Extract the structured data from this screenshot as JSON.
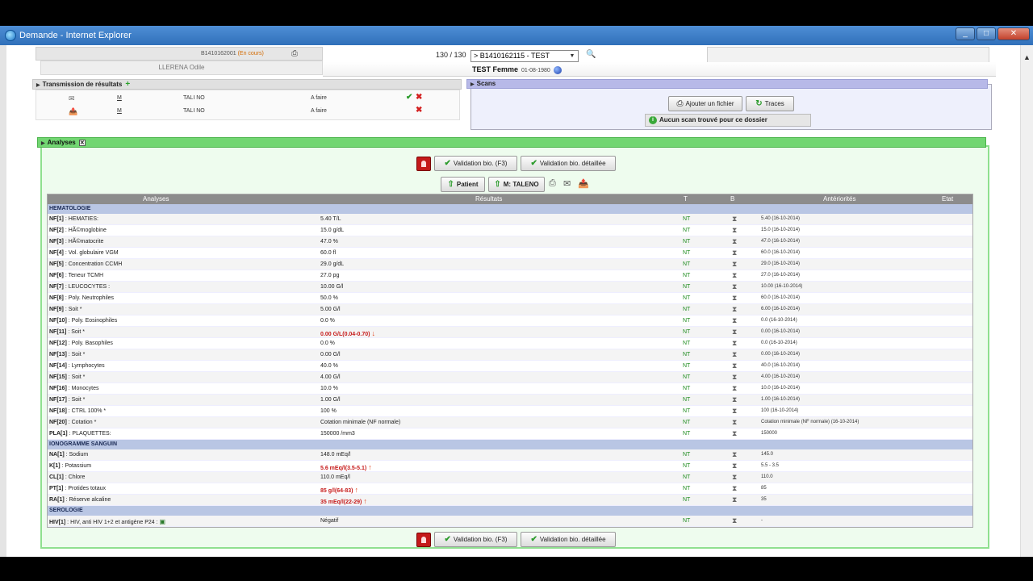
{
  "window": {
    "title": "Demande - Internet Explorer",
    "min": "_",
    "max": "□",
    "close": "✕"
  },
  "header": {
    "code": "B1410162001",
    "status": "(En cours)",
    "patient_sub": "LLERENA Odile",
    "nav_count": "130 / 130",
    "select_value": "> B1410162115 - TEST",
    "patient_name": "TEST Femme",
    "patient_dob": "01-08-1980"
  },
  "transmission": {
    "title": "Transmission de résultats",
    "rows": [
      {
        "m": "M",
        "name": "TALI NO",
        "status": "A faire"
      },
      {
        "m": "M",
        "name": "TALI NO",
        "status": "A faire"
      }
    ]
  },
  "scans": {
    "title": "Scans",
    "add_file": "Ajouter un fichier",
    "traces": "Traces",
    "none_found": "Aucun scan trouvé pour ce dossier"
  },
  "analyses": {
    "title": "Analyses",
    "validate": "Validation bio. (F3)",
    "validate_detail": "Validation bio. détaillée",
    "patient_btn": "Patient",
    "doctor_btn": "M: TALENO",
    "columns": {
      "analyses": "Analyses",
      "results": "Résultats",
      "t": "T",
      "b": "B",
      "anteriorities": "Antériorités",
      "state": "Etat"
    },
    "sections": [
      {
        "name": "HEMATOLOGIE",
        "rows": [
          {
            "code": "NF[1]",
            "label": " : HEMATIES:",
            "result": "5.40 T/L",
            "t": "NT",
            "ant": "5.40 (16-10-2014)"
          },
          {
            "code": "NF[2]",
            "label": " : HÃ©moglobine",
            "result": "15.0 g/dL",
            "t": "NT",
            "ant": "15.0 (16-10-2014)"
          },
          {
            "code": "NF[3]",
            "label": " : HÃ©matocrite",
            "result": "47.0 %",
            "t": "NT",
            "ant": "47.0 (16-10-2014)"
          },
          {
            "code": "NF[4]",
            "label": " : Vol. globulaire VGM",
            "result": "60.0 fl",
            "t": "NT",
            "ant": "60.0 (16-10-2014)"
          },
          {
            "code": "NF[5]",
            "label": " : Concentration CCMH",
            "result": "29.0 g/dL",
            "t": "NT",
            "ant": "29.0 (16-10-2014)"
          },
          {
            "code": "NF[6]",
            "label": " : Teneur TCMH",
            "result": "27.0 pg",
            "t": "NT",
            "ant": "27.0 (16-10-2014)"
          },
          {
            "code": "NF[7]",
            "label": " : LEUCOCYTES :",
            "result": "10.00 G/l",
            "t": "NT",
            "ant": "10.00 (16-10-2014)"
          },
          {
            "code": "NF[8]",
            "label": " : Poly. Neutrophiles",
            "result": "50.0 %",
            "t": "NT",
            "ant": "60.0 (16-10-2014)"
          },
          {
            "code": "NF[9]",
            "label": " : Soit *",
            "result": "5.00 G/l",
            "t": "NT",
            "ant": "6.00 (16-10-2014)"
          },
          {
            "code": "NF[10]",
            "label": " : Poly. Eosinophiles",
            "result": "0.0 %",
            "t": "NT",
            "ant": "0.0 (16-10-2014)"
          },
          {
            "code": "NF[11]",
            "label": " : Soit *",
            "result": "0.00 G/L(0.04-0.70)",
            "flag": "down",
            "t": "NT",
            "ant": "0.00 (16-10-2014)"
          },
          {
            "code": "NF[12]",
            "label": " : Poly. Basophiles",
            "result": "0.0 %",
            "t": "NT",
            "ant": "0.0 (16-10-2014)"
          },
          {
            "code": "NF[13]",
            "label": " : Soit *",
            "result": "0.00 G/l",
            "t": "NT",
            "ant": "0.00 (16-10-2014)"
          },
          {
            "code": "NF[14]",
            "label": " : Lymphocytes",
            "result": "40.0 %",
            "t": "NT",
            "ant": "40.0 (16-10-2014)"
          },
          {
            "code": "NF[15]",
            "label": " : Soit *",
            "result": "4.00 G/l",
            "t": "NT",
            "ant": "4.00 (16-10-2014)"
          },
          {
            "code": "NF[16]",
            "label": " : Monocytes",
            "result": "10.0 %",
            "t": "NT",
            "ant": "10.0 (16-10-2014)"
          },
          {
            "code": "NF[17]",
            "label": " : Soit *",
            "result": "1.00 G/l",
            "t": "NT",
            "ant": "1.00 (16-10-2014)"
          },
          {
            "code": "NF[18]",
            "label": " : CTRL 100% *",
            "result": "100 %",
            "t": "NT",
            "ant": "100 (16-10-2014)"
          },
          {
            "code": "NF[20]",
            "label": " : Cotation *",
            "result": "Cotation minimale (NF normale)",
            "t": "NT",
            "ant": "Cotation minimale (NF normale) (16-10-2014)"
          },
          {
            "code": "PLA[1]",
            "label": " : PLAQUETTES:",
            "result": "150000 /mm3",
            "t": "NT",
            "ant": "150000"
          }
        ]
      },
      {
        "name": "IONOGRAMME SANGUIN",
        "rows": [
          {
            "code": "NA[1]",
            "label": " : Sodium",
            "result": "148.0 mEq/l",
            "t": "NT",
            "ant": "145.0"
          },
          {
            "code": "K[1]",
            "label": " : Potassium",
            "result": "5.6 mEq/l(3.5-5.1)",
            "flag": "up",
            "t": "NT",
            "ant": "5.5 - 3.5"
          },
          {
            "code": "CL[1]",
            "label": " : Chlore",
            "result": "110.0 mEq/l",
            "t": "NT",
            "ant": "110.0"
          },
          {
            "code": "PT[1]",
            "label": " : Protides totaux",
            "result": "85 g/l(64-83)",
            "flag": "up",
            "t": "NT",
            "ant": "85"
          },
          {
            "code": "RA[1]",
            "label": " : Réserve alcaline",
            "result": "35 mEq/l(22-29)",
            "flag": "up",
            "t": "NT",
            "ant": "35"
          }
        ]
      },
      {
        "name": "SEROLOGIE",
        "rows": [
          {
            "code": "HIV[1]",
            "label": " : HIV, anti HIV 1+2 et antigène P24 :",
            "result": "Négatif",
            "t": "NT",
            "ant": "-"
          }
        ]
      }
    ]
  }
}
